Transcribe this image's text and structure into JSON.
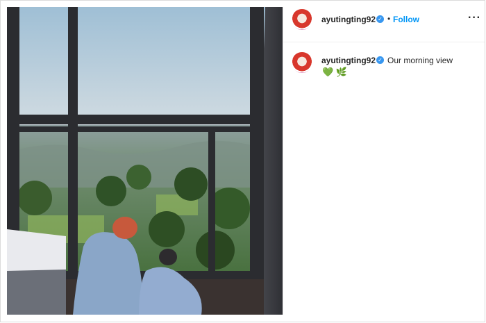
{
  "post": {
    "photo_icon": "photo",
    "header": {
      "username": "ayutingting92",
      "verified_icon": "verified-badge",
      "separator": "•",
      "follow_label": "Follow",
      "more_label": "···"
    },
    "caption": {
      "username": "ayutingting92",
      "verified_icon": "verified-badge",
      "text": "Our morning view",
      "emojis": {
        "heart": "💚",
        "leaf": "🌿"
      }
    },
    "colors": {
      "accent": "#0095f6",
      "verified": "#3897f0",
      "text": "#262626",
      "border": "#dbdbdb"
    }
  }
}
